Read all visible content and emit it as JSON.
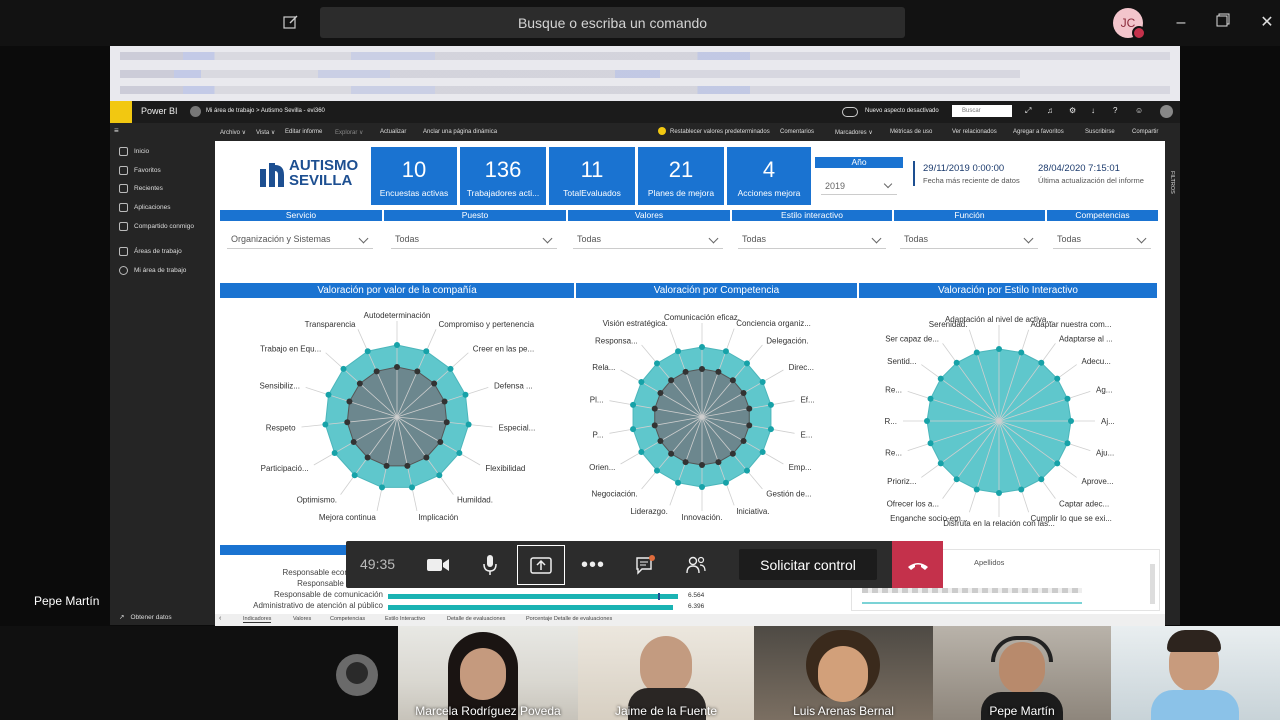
{
  "teams": {
    "search_placeholder": "Busque o escriba un comando",
    "avatar_initials": "JC",
    "presenter_name": "Pepe Martín"
  },
  "powerbi": {
    "app_name": "Power BI",
    "breadcrumb": "Mi área de trabajo  >  Autismo Sevilla - evi360",
    "new_look": "Nuevo aspecto desactivado",
    "search": "Buscar",
    "toolbar": {
      "archivo": "Archivo ∨",
      "vista": "Vista ∨",
      "editar": "Editar informe",
      "explorar": "Explorar ∨",
      "actualizar": "Actualizar",
      "anclar": "Anclar una página dinámica",
      "restablecer": "Restablecer valores predeterminados",
      "comentarios": "Comentarios",
      "marcadores": "Marcadores ∨",
      "metricas": "Métricas de uso",
      "ver_relacionados": "Ver relacionados",
      "agregar_favoritos": "Agregar a favoritos",
      "suscribirse": "Suscribirse",
      "compartir": "Compartir"
    },
    "nav": [
      "Inicio",
      "Favoritos",
      "Recientes",
      "Aplicaciones",
      "Compartido conmigo",
      "Áreas de trabajo",
      "Mi área de trabajo"
    ],
    "nav_bottom": "Obtener datos",
    "filters_label": "FILTROS",
    "tabs": [
      "Indicadores",
      "Valores",
      "Competencias",
      "Estilo Interactivo",
      "Detalle de evaluaciones",
      "Porcentaje Detalle de evaluaciones"
    ]
  },
  "report": {
    "logo_line1": "AUTISMO",
    "logo_line2": "SEVILLA",
    "kpis": [
      {
        "value": "10",
        "label": "Encuestas activas"
      },
      {
        "value": "136",
        "label": "Trabajadores acti..."
      },
      {
        "value": "11",
        "label": "TotalEvaluados"
      },
      {
        "value": "21",
        "label": "Planes de mejora"
      },
      {
        "value": "4",
        "label": "Acciones mejora"
      }
    ],
    "year_label": "Año",
    "year_value": "2019",
    "date1": "29/11/2019 0:00:00",
    "date1_label": "Fecha más reciente de datos",
    "date2": "28/04/2020 7:15:01",
    "date2_label": "Última actualización del informe",
    "filters": [
      {
        "header": "Servicio",
        "value": "Organización y Sistemas"
      },
      {
        "header": "Puesto",
        "value": "Todas"
      },
      {
        "header": "Valores",
        "value": "Todas"
      },
      {
        "header": "Estilo interactivo",
        "value": "Todas"
      },
      {
        "header": "Función",
        "value": "Todas"
      },
      {
        "header": "Competencias",
        "value": "Todas"
      }
    ],
    "charts": [
      {
        "title": "Valoración por valor de la compañía",
        "labels": [
          "Autodeterminación",
          "Compromiso y pertenencia",
          "Creer en las pe...",
          "Defensa ...",
          "Especial...",
          "Flexibilidad",
          "Humildad.",
          "Implicación",
          "Mejora continua",
          "Optimismo.",
          "Participació...",
          "Respeto",
          "Sensibiliz...",
          "Trabajo en Equ...",
          "Transparencia"
        ]
      },
      {
        "title": "Valoración por Competencia",
        "labels": [
          "Comunicación eficaz.",
          "Conciencia organiz...",
          "Delegación.",
          "Direc...",
          "Ef...",
          "E...",
          "Emp...",
          "Gestión de...",
          "Iniciativa.",
          "Innovación.",
          "Liderazgo.",
          "Negociación.",
          "Orien...",
          "P...",
          "Pl...",
          "Rela...",
          "Responsa...",
          "Visión estratégica."
        ]
      },
      {
        "title": "Valoración por Estilo Interactivo",
        "labels": [
          "Adaptación al nivel de activa...",
          "Adaptar nuestra com...",
          "Adaptarse al ...",
          "Adecu...",
          "Ag...",
          "Aj...",
          "Aju...",
          "Aprove...",
          "Captar adec...",
          "Cumplir lo que se exi...",
          "Disfruta en la relación con las...",
          "Enganche socio-em...",
          "Ofrecer los a...",
          "Prioriz...",
          "Re...",
          "R...",
          "Re...",
          "Sentid...",
          "Ser capaz de...",
          "Serenidad."
        ]
      }
    ],
    "bars": [
      {
        "label": "Responsable económico fi...",
        "value": ""
      },
      {
        "label": "Responsable Área de ...",
        "value": ""
      },
      {
        "label": "Responsable de comunicación",
        "value": "6.564"
      },
      {
        "label": "Administrativo de atención al público",
        "value": "6.396"
      }
    ],
    "table_header": "Apellidos"
  },
  "call": {
    "time": "49:35",
    "request_control": "Solicitar control"
  },
  "participants": [
    "Marcela Rodríguez Poveda",
    "Jaime de la Fuente",
    "Luis Arenas Bernal",
    "Pepe Martín"
  ],
  "colors": {
    "accent": "#1a73d1",
    "radar_fill": "#5fc7cc",
    "radar_inner": "#6e7b82",
    "hangup": "#c4314b"
  }
}
